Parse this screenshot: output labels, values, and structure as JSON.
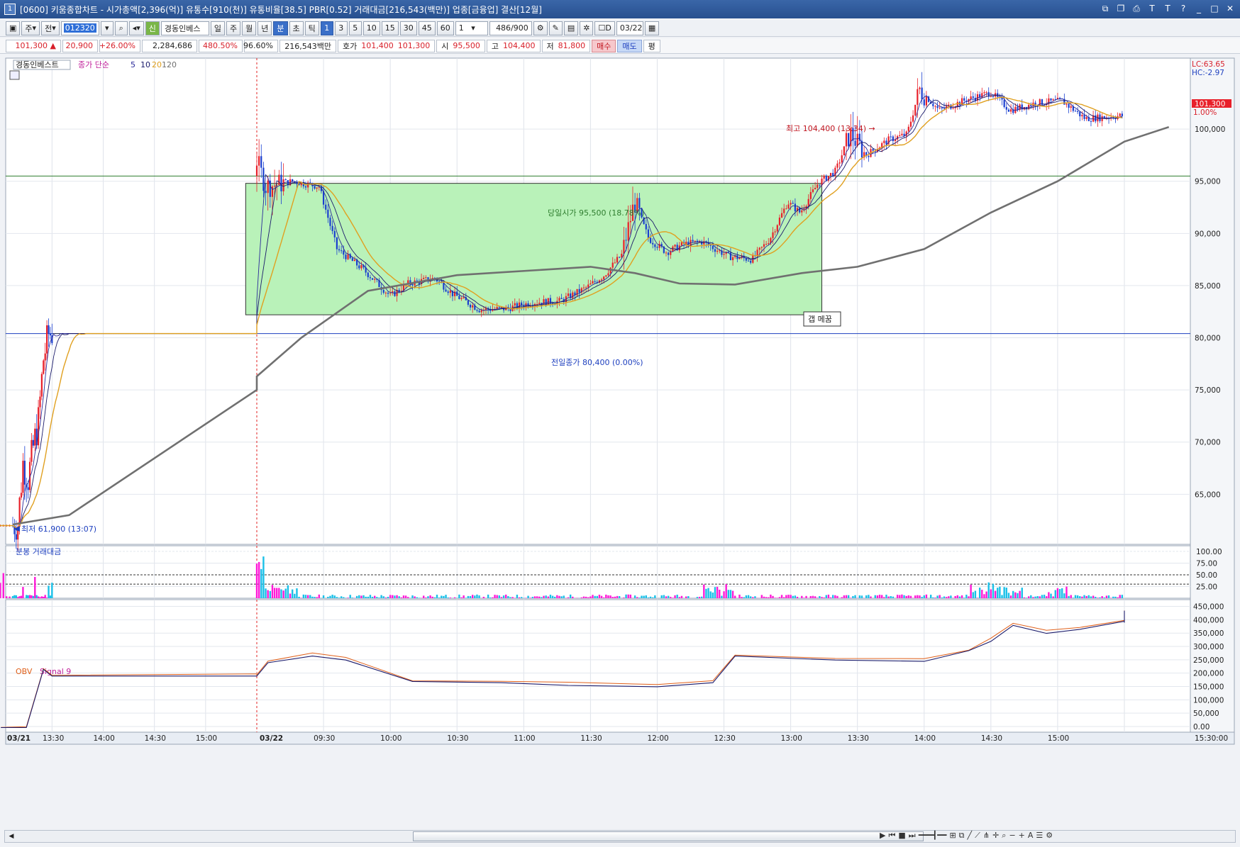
{
  "window": {
    "title": "[0600] 키움종합차트 - 시가총액[2,396(억)] 유통수[910(천)] 유통비율[38.5] PBR[0.52] 거래대금[216,543(백만)] 업종[금융업] 결산[12월]",
    "num": "1"
  },
  "toolbar": {
    "jong": "주",
    "jeon": "전",
    "code": "012320",
    "sin": "신",
    "stock_name": "경동인베스",
    "periods": [
      "일",
      "주",
      "월",
      "년",
      "분",
      "초",
      "틱"
    ],
    "selected_period": "분",
    "intervals": [
      "1",
      "3",
      "5",
      "10",
      "15",
      "30",
      "45",
      "60"
    ],
    "selected_interval": "1",
    "count_sel": "1",
    "count": "486",
    "count_max": "/900",
    "date": "03/22"
  },
  "quote": {
    "price": "101,300",
    "arrow": "▲",
    "change": "20,900",
    "pct": "+26.00%",
    "volume": "2,284,686",
    "ratio1": "480.50%",
    "ratio2": "96.60%",
    "amount": "216,543백만",
    "hoga_label": "호가",
    "hoga1": "101,400",
    "hoga2": "101,300",
    "open_label": "시",
    "open": "95,500",
    "high_label": "고",
    "high": "104,400",
    "low_label": "저",
    "low": "81,800",
    "buy": "매수",
    "sell": "매도",
    "flat": "평"
  },
  "legend": {
    "name": "경동인베스트",
    "ma": "종가 단순",
    "ma1": "5",
    "ma2": "10",
    "ma3": "20",
    "ma4": "120"
  },
  "price_axis": {
    "ticks": [
      "100,000",
      "95,000",
      "90,000",
      "85,000",
      "80,000",
      "75,000",
      "70,000",
      "65,000"
    ],
    "lc": "LC:63.65",
    "hc": "HC:-2.97",
    "cur_price": "101,300",
    "cur_pct": "1.00%"
  },
  "annotations": {
    "high": "최고 104,400 (13:34)",
    "low": "최저 61,900 (13:07)",
    "open": "당일시가 95,500 (18.78%)",
    "prev": "전일종가 80,400 (0.00%)",
    "gap": "갭 메꿈"
  },
  "volume_panel": {
    "title": "분봉 거래대금",
    "ticks": [
      "100.00",
      "75.00",
      "50.00",
      "25.00"
    ]
  },
  "obv_panel": {
    "title": "OBV",
    "signal": "Signal 9",
    "ticks": [
      "450,000",
      "400,000",
      "350,000",
      "300,000",
      "250,000",
      "200,000",
      "150,000",
      "100,000",
      "50,000",
      "0.00"
    ]
  },
  "time_axis": {
    "labels": [
      "03/21",
      "13:30",
      "14:00",
      "14:30",
      "15:00",
      "03/22",
      "09:30",
      "10:00",
      "10:30",
      "11:00",
      "11:30",
      "12:00",
      "12:30",
      "13:00",
      "13:30",
      "14:00",
      "14:30",
      "15:00",
      "15:30:00"
    ]
  },
  "colors": {
    "up": "#e8202a",
    "down": "#1a3fd0",
    "ma5": "#2a2a9a",
    "ma10": "#1a1a6a",
    "ma20": "#e0a020",
    "ma120": "#707070",
    "box": "#b9f2b9",
    "vol_up": "#ff1ad8",
    "vol_down": "#1ac0e8",
    "obv": "#1a1a6a",
    "signal": "#e0601a"
  },
  "chart_data": [
    {
      "type": "candlestick",
      "title": "",
      "series": [
        {
          "name": "경동인베스트"
        }
      ],
      "ylim": [
        61900,
        104400
      ],
      "high": 104400,
      "low": 61900,
      "open": 95500,
      "prev_close": 80400,
      "last": 101300
    },
    {
      "type": "bar",
      "title": "분봉 거래대금",
      "ylim": [
        0,
        100
      ]
    },
    {
      "type": "line",
      "title": "OBV",
      "series": [
        {
          "name": "OBV"
        },
        {
          "name": "Signal 9"
        }
      ],
      "ylim": [
        0,
        450000
      ]
    }
  ]
}
